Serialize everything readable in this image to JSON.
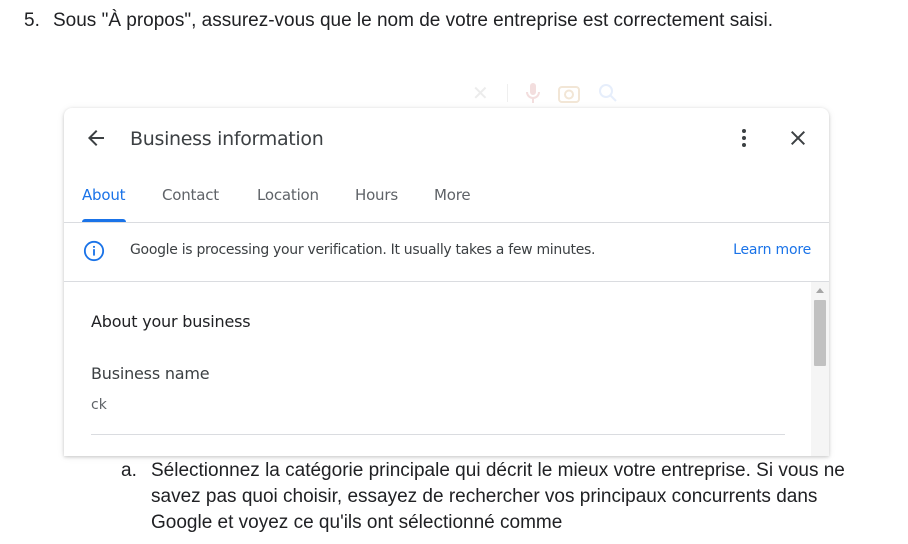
{
  "instruction": {
    "number": "5.",
    "text": "Sous \"À propos\", assurez-vous que le nom de votre entreprise est correctement saisi."
  },
  "dialog": {
    "title": "Business information",
    "tabs": [
      {
        "label": "About",
        "active": true
      },
      {
        "label": "Contact",
        "active": false
      },
      {
        "label": "Location",
        "active": false
      },
      {
        "label": "Hours",
        "active": false
      },
      {
        "label": "More",
        "active": false
      }
    ],
    "notice": {
      "text": "Google is processing your verification. It usually takes a few minutes.",
      "link": "Learn more"
    },
    "section_title": "About your business",
    "field": {
      "label": "Business name",
      "value": "ck"
    }
  },
  "sub_instruction": {
    "number": "a.",
    "text": "Sélectionnez la catégorie principale qui décrit le mieux votre entreprise. Si vous ne savez pas quoi choisir, essayez de rechercher vos principaux concurrents dans Google et voyez ce qu'ils ont sélectionné comme"
  },
  "colors": {
    "accent": "#1a73e8",
    "divider": "#dadce0",
    "text": "#3c4043"
  },
  "icons": [
    "back-arrow-icon",
    "more-vert-icon",
    "close-icon",
    "info-icon",
    "mic-icon",
    "camera-icon",
    "search-icon"
  ]
}
